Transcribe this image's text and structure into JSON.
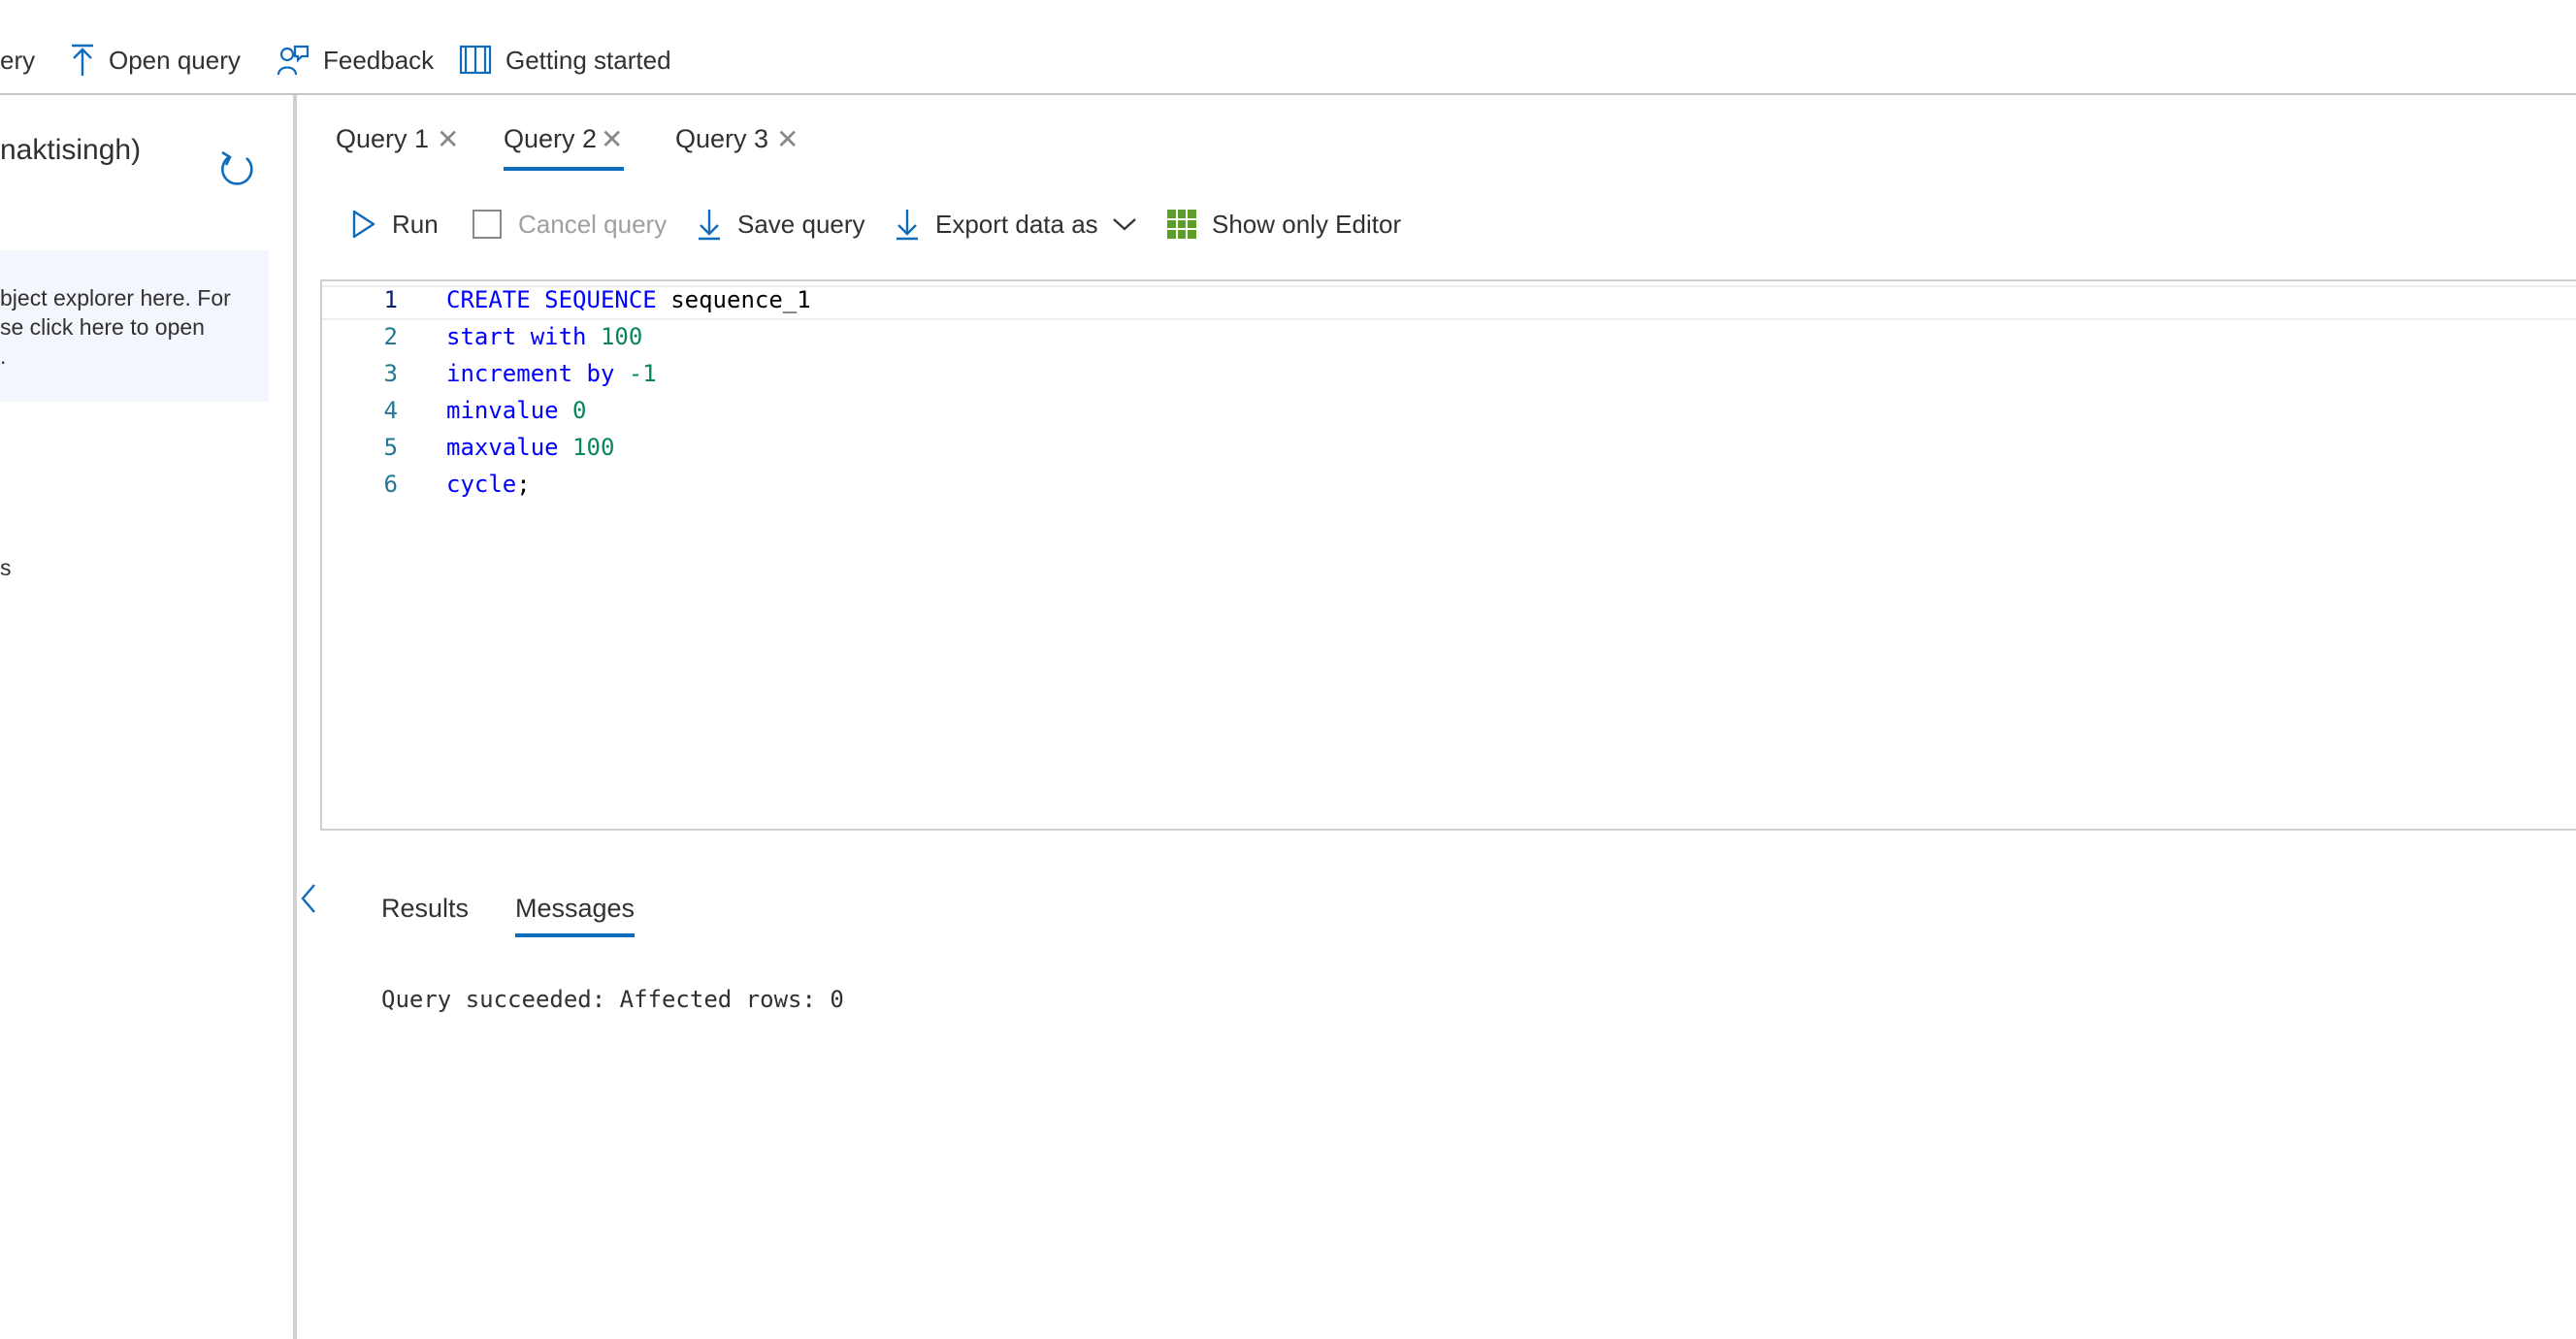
{
  "toolbar": {
    "partial_item": "ery",
    "open_query": "Open query",
    "feedback": "Feedback",
    "getting_started": "Getting started"
  },
  "left_pane": {
    "title_partial": "naktisingh)",
    "info_lines": [
      "bject explorer here. For",
      "se click here to open",
      "."
    ],
    "partial_item": "s"
  },
  "tabs": [
    {
      "label": "Query 1",
      "active": false
    },
    {
      "label": "Query 2",
      "active": true
    },
    {
      "label": "Query 3",
      "active": false
    }
  ],
  "commands": {
    "run": "Run",
    "cancel": "Cancel query",
    "save": "Save query",
    "export": "Export data as",
    "show_only_editor": "Show only Editor"
  },
  "editor": {
    "line_numbers": [
      "1",
      "2",
      "3",
      "4",
      "5",
      "6"
    ],
    "lines": [
      {
        "kw": "CREATE SEQUENCE",
        "rest": " sequence_1"
      },
      {
        "kw": "start with",
        "num": " 100"
      },
      {
        "kw": "increment by",
        "num": " -1"
      },
      {
        "kw": "minvalue",
        "num": " 0"
      },
      {
        "kw": "maxvalue",
        "num": " 100"
      },
      {
        "kw": "cycle",
        "rest": ";"
      }
    ]
  },
  "results": {
    "tabs": [
      "Results",
      "Messages"
    ],
    "active_tab": "Messages",
    "message": "Query succeeded: Affected rows: 0"
  },
  "colors": {
    "accent": "#0f6cbd",
    "keyword": "#0000ff",
    "number": "#098658",
    "grid_icon": "#5b9f2a"
  }
}
